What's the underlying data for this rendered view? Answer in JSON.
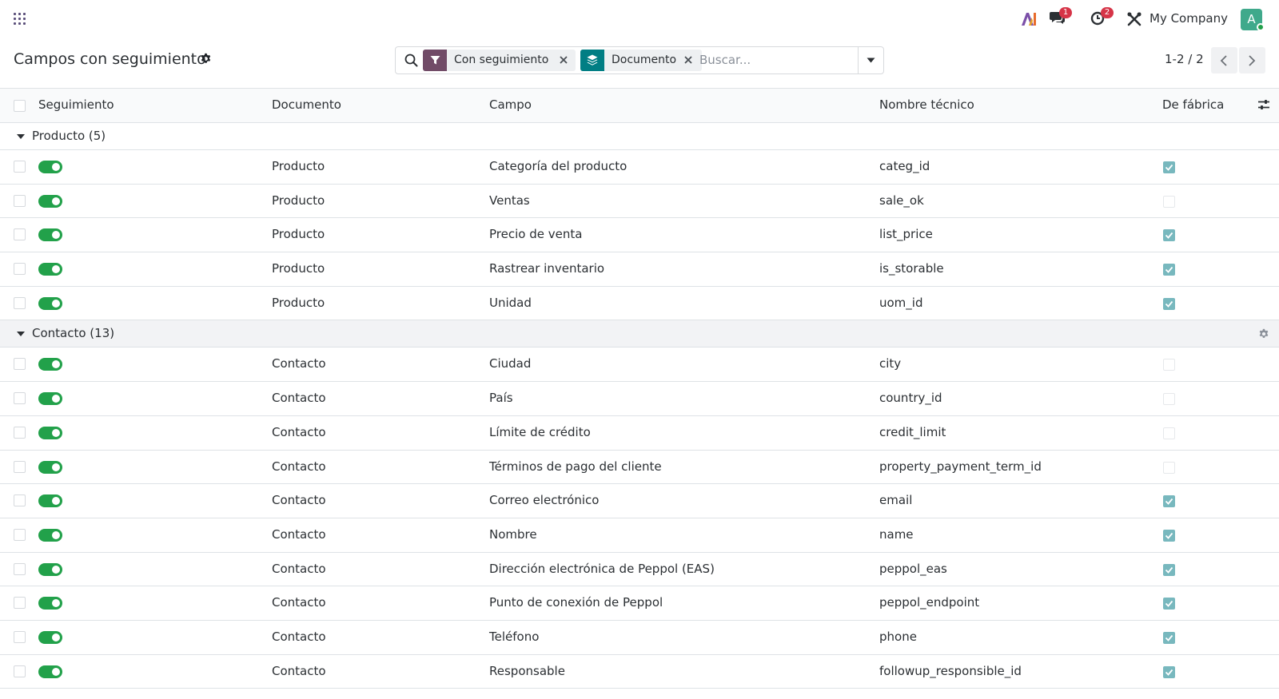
{
  "navbar": {
    "messages_badge": "1",
    "activities_badge": "2",
    "company": "My Company",
    "avatar_initial": "A"
  },
  "control_panel": {
    "title": "Campos con seguimiento",
    "facets": [
      {
        "label": "Con seguimiento",
        "icon": "filter-icon",
        "color": "#714b67"
      },
      {
        "label": "Documento",
        "icon": "layers-icon",
        "color": "#017e84"
      }
    ],
    "search_placeholder": "Buscar...",
    "pager": "1-2 / 2"
  },
  "table": {
    "columns": [
      "Seguimiento",
      "Documento",
      "Campo",
      "Nombre técnico",
      "De fábrica"
    ],
    "groups": [
      {
        "label": "Producto (5)",
        "rows": [
          {
            "documento": "Producto",
            "campo": "Categoría del producto",
            "nombre": "categ_id",
            "tracking": true,
            "fabrica": true
          },
          {
            "documento": "Producto",
            "campo": "Ventas",
            "nombre": "sale_ok",
            "tracking": true,
            "fabrica": false
          },
          {
            "documento": "Producto",
            "campo": "Precio de venta",
            "nombre": "list_price",
            "tracking": true,
            "fabrica": true
          },
          {
            "documento": "Producto",
            "campo": "Rastrear inventario",
            "nombre": "is_storable",
            "tracking": true,
            "fabrica": true
          },
          {
            "documento": "Producto",
            "campo": "Unidad",
            "nombre": "uom_id",
            "tracking": true,
            "fabrica": true
          }
        ]
      },
      {
        "label": "Contacto (13)",
        "rows": [
          {
            "documento": "Contacto",
            "campo": "Ciudad",
            "nombre": "city",
            "tracking": true,
            "fabrica": false
          },
          {
            "documento": "Contacto",
            "campo": "País",
            "nombre": "country_id",
            "tracking": true,
            "fabrica": false
          },
          {
            "documento": "Contacto",
            "campo": "Límite de crédito",
            "nombre": "credit_limit",
            "tracking": true,
            "fabrica": false
          },
          {
            "documento": "Contacto",
            "campo": "Términos de pago del cliente",
            "nombre": "property_payment_term_id",
            "tracking": true,
            "fabrica": false
          },
          {
            "documento": "Contacto",
            "campo": "Correo electrónico",
            "nombre": "email",
            "tracking": true,
            "fabrica": true
          },
          {
            "documento": "Contacto",
            "campo": "Nombre",
            "nombre": "name",
            "tracking": true,
            "fabrica": true
          },
          {
            "documento": "Contacto",
            "campo": "Dirección electrónica de Peppol (EAS)",
            "nombre": "peppol_eas",
            "tracking": true,
            "fabrica": true
          },
          {
            "documento": "Contacto",
            "campo": "Punto de conexión de Peppol",
            "nombre": "peppol_endpoint",
            "tracking": true,
            "fabrica": true
          },
          {
            "documento": "Contacto",
            "campo": "Teléfono",
            "nombre": "phone",
            "tracking": true,
            "fabrica": true
          },
          {
            "documento": "Contacto",
            "campo": "Responsable",
            "nombre": "followup_responsible_id",
            "tracking": true,
            "fabrica": true
          }
        ]
      }
    ]
  }
}
